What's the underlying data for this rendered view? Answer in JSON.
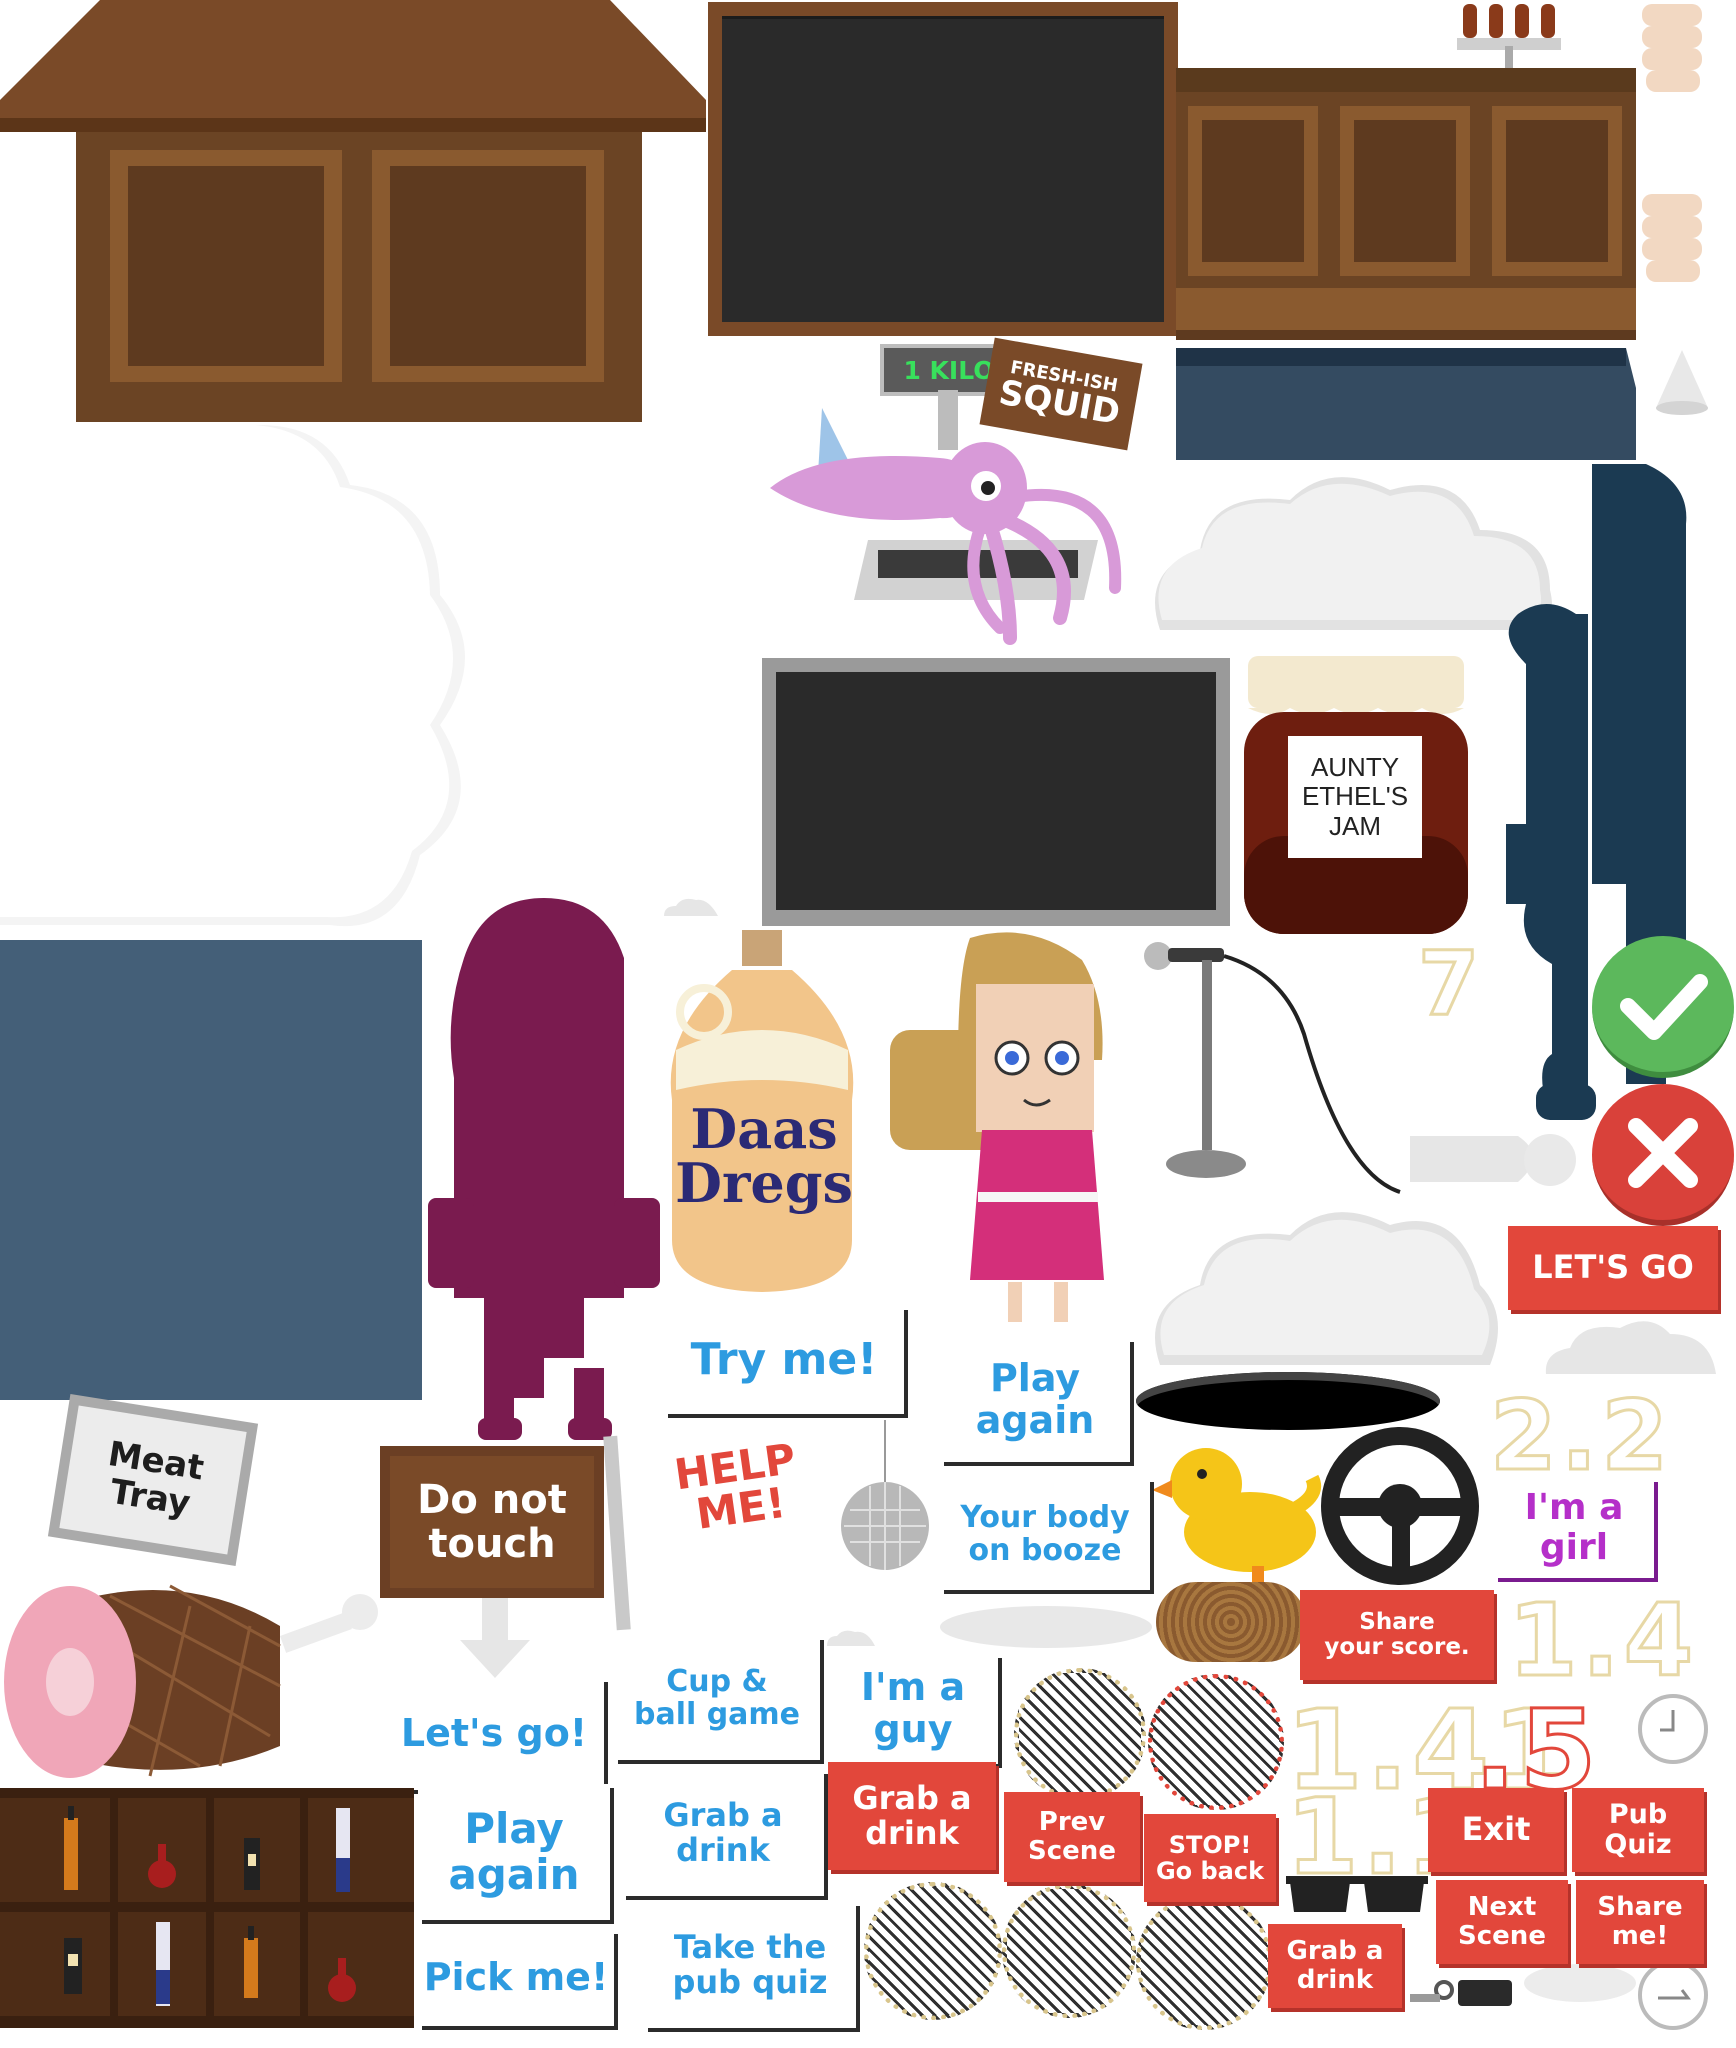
{
  "colors": {
    "wood": "#6b4424",
    "wood_dark": "#4f3119",
    "slate": "#3c3c3c",
    "navy": "#1b3a52",
    "plum": "#7a1b4f",
    "button_blue_text": "#2d9be0",
    "button_red": "#e2473b",
    "purple_text": "#b52fc9",
    "green_ok": "#5cb85c",
    "red_no": "#d9413a"
  },
  "props": {
    "scale_display": "1 KILO",
    "squid_sign": [
      "FRESH-ISH",
      "SQUID"
    ],
    "jam_label": [
      "AUNTY",
      "ETHEL'S",
      "JAM"
    ],
    "jug_label": [
      "Daas",
      "Dregs"
    ],
    "meat_sign": [
      "Meat",
      "Tray"
    ],
    "do_not_touch_sign": [
      "Do not",
      "touch"
    ],
    "help_text": [
      "HELP",
      "ME!"
    ]
  },
  "white_buttons": {
    "try_me": "Try me!",
    "play_again_top": [
      "Play",
      "again"
    ],
    "your_body": [
      "Your body",
      "on booze"
    ],
    "lets_go_lower": "Let's go!",
    "cup_ball": [
      "Cup &",
      "ball game"
    ],
    "im_a_guy": [
      "I'm a",
      "guy"
    ],
    "play_again_bottom": [
      "Play",
      "again"
    ],
    "grab_drink_white": [
      "Grab a",
      "drink"
    ],
    "pick_me": "Pick me!",
    "take_quiz": [
      "Take the",
      "pub quiz"
    ],
    "im_a_girl": [
      "I'm a",
      "girl"
    ]
  },
  "red_buttons": {
    "lets_go": "LET'S GO",
    "share_score": [
      "Share",
      "your score."
    ],
    "grab_drink_1": [
      "Grab a",
      "drink"
    ],
    "prev_scene": [
      "Prev",
      "Scene"
    ],
    "stop_go_back": [
      "STOP!",
      "Go back"
    ],
    "exit": "Exit",
    "pub_quiz": [
      "Pub",
      "Quiz"
    ],
    "next_scene": [
      "Next",
      "Scene"
    ],
    "share_me": [
      "Share",
      "me!"
    ],
    "grab_drink_2": [
      "Grab a",
      "drink"
    ]
  },
  "numerals": {
    "n7": "7",
    "n22": "2.2",
    "n14": "1.4",
    "n141": "1.41",
    "n15": ".5",
    "n11": "1.1"
  },
  "icons": [
    "checkmark-icon",
    "cross-icon",
    "clock-icon",
    "disco-ball-icon",
    "steering-wheel-icon",
    "duck-icon",
    "microphone-icon",
    "keys-icon",
    "sunglasses-icon"
  ]
}
